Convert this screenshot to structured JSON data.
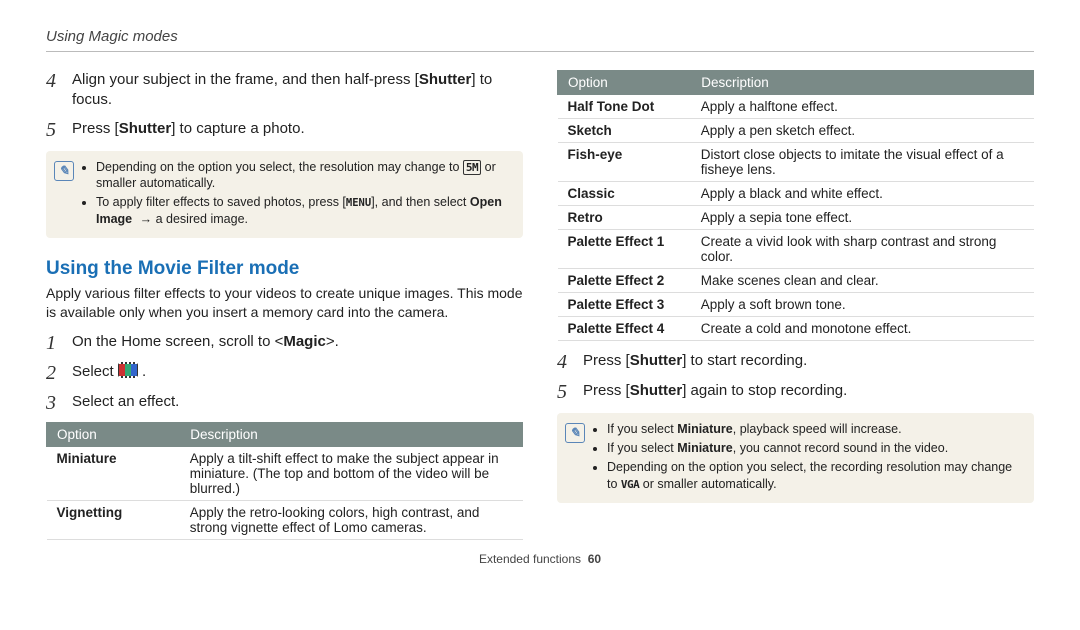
{
  "header": "Using Magic modes",
  "left": {
    "steps_a": [
      {
        "n": "4",
        "prefix": "Align your subject in the frame, and then half-press [",
        "bold": "Shutter",
        "suffix": "] to focus."
      },
      {
        "n": "5",
        "prefix": "Press [",
        "bold": "Shutter",
        "suffix": "] to capture a photo."
      }
    ],
    "note1": {
      "bullet1_a": "Depending on the option you select, the resolution may change to ",
      "bullet1_glyph": "5M",
      "bullet1_b": " or smaller automatically.",
      "bullet2_a": "To apply filter effects to saved photos, press [",
      "bullet2_menu": "MENU",
      "bullet2_b": "], and then select ",
      "bullet2_bold": "Open Image",
      "bullet2_c": " → a desired image."
    },
    "section_title": "Using the Movie Filter mode",
    "section_intro": "Apply various filter effects to your videos to create unique images. This mode is available only when you insert a memory card into the camera.",
    "steps_b": [
      {
        "n": "1",
        "prefix": "On the Home screen, scroll to <",
        "bold": "Magic",
        "suffix": ">."
      },
      {
        "n": "2",
        "text": "Select "
      },
      {
        "n": "3",
        "text": "Select an effect."
      }
    ],
    "table": {
      "h1": "Option",
      "h2": "Description",
      "rows": [
        {
          "opt": "Miniature",
          "desc": "Apply a tilt-shift effect to make the subject appear in miniature. (The top and bottom of the video will be blurred.)"
        },
        {
          "opt": "Vignetting",
          "desc": "Apply the retro-looking colors, high contrast, and strong vignette effect of Lomo cameras."
        }
      ]
    }
  },
  "right": {
    "table": {
      "h1": "Option",
      "h2": "Description",
      "rows": [
        {
          "opt": "Half Tone Dot",
          "desc": "Apply a halftone effect."
        },
        {
          "opt": "Sketch",
          "desc": "Apply a pen sketch effect."
        },
        {
          "opt": "Fish-eye",
          "desc": "Distort close objects to imitate the visual effect of a fisheye lens."
        },
        {
          "opt": "Classic",
          "desc": "Apply a black and white effect."
        },
        {
          "opt": "Retro",
          "desc": "Apply a sepia tone effect."
        },
        {
          "opt": "Palette Effect 1",
          "desc": "Create a vivid look with sharp contrast and strong color."
        },
        {
          "opt": "Palette Effect 2",
          "desc": "Make scenes clean and clear."
        },
        {
          "opt": "Palette Effect 3",
          "desc": "Apply a soft brown tone."
        },
        {
          "opt": "Palette Effect 4",
          "desc": "Create a cold and monotone effect."
        }
      ]
    },
    "steps": [
      {
        "n": "4",
        "prefix": "Press [",
        "bold": "Shutter",
        "suffix": "] to start recording."
      },
      {
        "n": "5",
        "prefix": "Press [",
        "bold": "Shutter",
        "suffix": "] again to stop recording."
      }
    ],
    "note2": {
      "b1_a": "If you select ",
      "b1_bold": "Miniature",
      "b1_b": ", playback speed will increase.",
      "b2_a": "If you select ",
      "b2_bold": "Miniature",
      "b2_b": ", you cannot record sound in the video.",
      "b3_a": "Depending on the option you select, the recording resolution may change to ",
      "b3_glyph": "VGA",
      "b3_b": " or smaller automatically."
    }
  },
  "footer": {
    "section": "Extended functions",
    "page": "60"
  }
}
